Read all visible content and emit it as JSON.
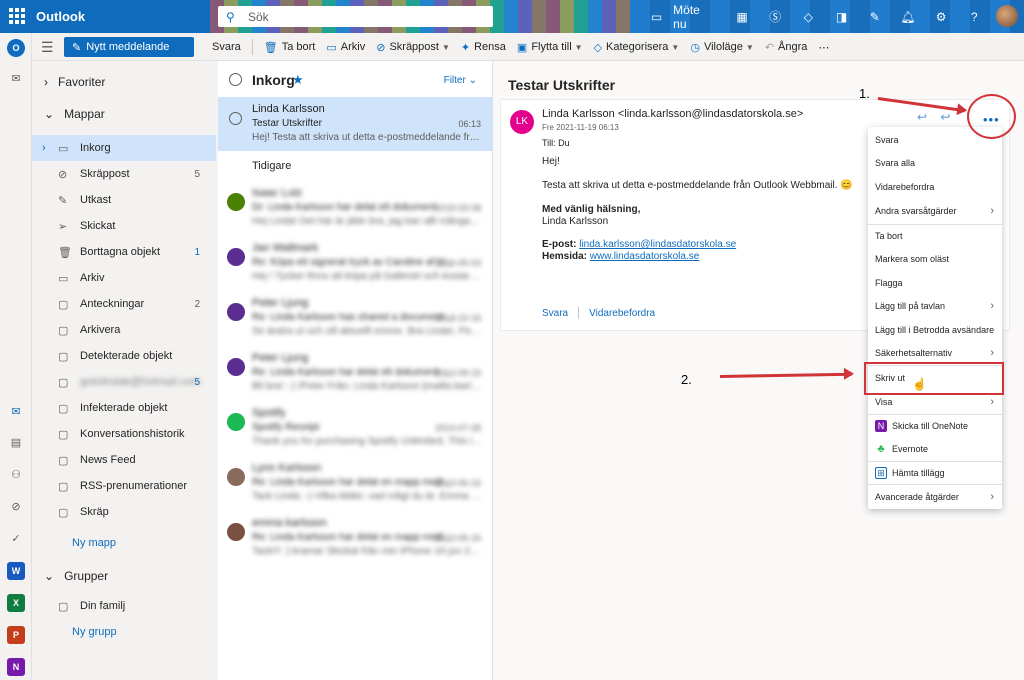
{
  "topbar": {
    "app_name": "Outlook",
    "search_placeholder": "Sök",
    "meeting_label": "Möte nu"
  },
  "toolbar": {
    "new_message": "Nytt meddelande",
    "commands": [
      "Svara",
      "Ta bort",
      "Arkiv",
      "Skräppost",
      "Rensa",
      "Flytta till",
      "Kategorisera",
      "Viloläge",
      "Ångra"
    ]
  },
  "sidebar": {
    "favorites": "Favoriter",
    "folders": "Mappar",
    "items": [
      {
        "label": "Inkorg",
        "count": ""
      },
      {
        "label": "Skräppost",
        "count": "5"
      },
      {
        "label": "Utkast",
        "count": ""
      },
      {
        "label": "Skickat",
        "count": ""
      },
      {
        "label": "Borttagna objekt",
        "count": "1"
      },
      {
        "label": "Arkiv",
        "count": ""
      },
      {
        "label": "Anteckningar",
        "count": "2"
      },
      {
        "label": "Arkivera",
        "count": ""
      },
      {
        "label": "Detekterade objekt",
        "count": ""
      },
      {
        "label": "gotolindak@hotmail.com",
        "count": "5"
      },
      {
        "label": "Infekterade objekt",
        "count": ""
      },
      {
        "label": "Konversationshistorik",
        "count": ""
      },
      {
        "label": "News Feed",
        "count": ""
      },
      {
        "label": "RSS-prenumerationer",
        "count": ""
      },
      {
        "label": "Skräp",
        "count": ""
      }
    ],
    "new_folder": "Ny mapp",
    "groups": "Grupper",
    "group_items": [
      "Din familj"
    ],
    "new_group": "Ny grupp"
  },
  "message_list": {
    "title": "Inkorg",
    "filter": "Filter",
    "selected": {
      "from": "Linda Karlsson",
      "subject": "Testar Utskrifter",
      "time": "06:13",
      "preview": "Hej! Testa att skriva ut detta e-postmeddelande från O..."
    },
    "earlier_label": "Tidigare",
    "older": [
      {
        "from": "Isaac Lutz",
        "subject": "Dr: Linda Karlsson har delat ett dokument",
        "preview": "Hej Linda! Det här är jätte bra, jag kan allt många ä...",
        "time": "2019-03-08"
      },
      {
        "from": "Jan Wallmark",
        "subject": "Re: Köpa ett signerat tryck av Caroline af U...",
        "preview": "Hej ! Tycker finns att köpa på Galleriet och kostar 6.00...",
        "time": "2016-05-03"
      },
      {
        "from": "Peter Ljung",
        "subject": "Re: Linda Karlsson has shared a document ...",
        "preview": "Se ändra ut och vill aktuellt emme. Bra Linda!, Peter...",
        "time": "2013-10-16"
      },
      {
        "from": "Peter Ljung",
        "subject": "Re: Linda Karlsson har delat ett dokument ...",
        "preview": "Bli bra! :-) /Peter Från: Linda Karlsson [mailto:karlsson]...",
        "time": "2013-09-19"
      },
      {
        "from": "Spotify",
        "subject": "Spotify Receipt",
        "preview": "Thank you for purchasing Spotify Unlimited. This is you...",
        "time": "2013-07-28"
      },
      {
        "from": "Lynn Karlsson",
        "subject": "Re: Linda Karlsson har delat en mapp med...",
        "preview": "Tack Linda :-) Vilka bilder, vad roligt du är. Emma hade...",
        "time": "2013-06-16"
      },
      {
        "from": "emma karlsson",
        "subject": "Re: Linda Karlsson har delat en mapp med...",
        "preview": "Tack!!! :) kramar Skickat från min iPhone 16 jun 2013 kl...",
        "time": "2013-06-16"
      }
    ]
  },
  "reading": {
    "title": "Testar Utskrifter",
    "avatar_initials": "LK",
    "sender": "Linda Karlsson <linda.karlsson@lindasdatorskola.se>",
    "date": "Fre 2021-11-19 06:13",
    "to": "Till:  Du",
    "greeting": "Hej!",
    "body": "Testa att skriva ut detta e-postmeddelande från Outlook Webbmail. 😊",
    "sign_1": "Med vänlig hälsning,",
    "sign_2": "Linda Karlsson",
    "email_label": "E-post:",
    "email": "linda.karlsson@lindasdatorskola.se",
    "web_label": "Hemsida:",
    "web": "www.lindasdatorskola.se",
    "reply": "Svara",
    "forward": "Vidarebefordra"
  },
  "context_menu": {
    "items": [
      {
        "label": "Svara",
        "sub": false
      },
      {
        "label": "Svara alla",
        "sub": false
      },
      {
        "label": "Vidarebefordra",
        "sub": false
      },
      {
        "label": "Andra svarsåtgärder",
        "sub": true
      },
      {
        "label": "Ta bort",
        "sub": false
      },
      {
        "label": "Markera som oläst",
        "sub": false
      },
      {
        "label": "Flagga",
        "sub": false
      },
      {
        "label": "Lägg till på tavlan",
        "sub": true
      },
      {
        "label": "Lägg till i Betrodda avsändare",
        "sub": false
      },
      {
        "label": "Säkerhetsalternativ",
        "sub": true
      },
      {
        "label": "Skriv ut",
        "sub": false
      },
      {
        "label": "Visa",
        "sub": true
      },
      {
        "label": "Skicka till OneNote",
        "sub": false
      },
      {
        "label": "Evernote",
        "sub": false
      },
      {
        "label": "Hämta tillägg",
        "sub": false
      },
      {
        "label": "Avancerade åtgärder",
        "sub": true
      }
    ]
  },
  "annotations": {
    "step1": "1.",
    "step2": "2."
  },
  "colors": {
    "brand": "#0f6cbd",
    "highlight": "#d13438",
    "selected": "#cfe4fa",
    "avatar": "#e3008c"
  }
}
